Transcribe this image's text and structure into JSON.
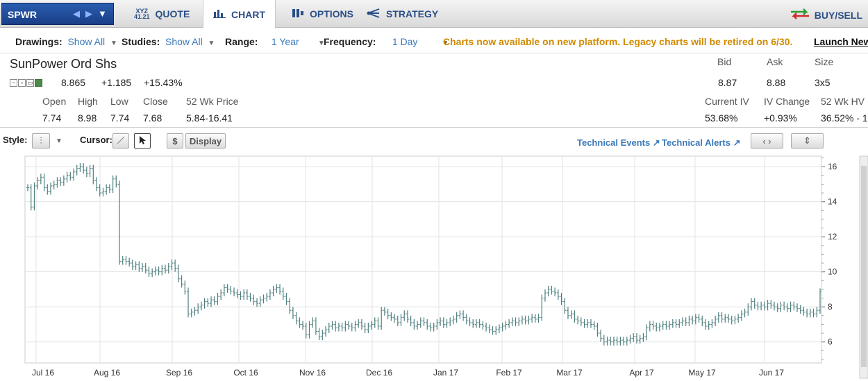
{
  "header": {
    "symbol": "SPWR",
    "tabs": [
      {
        "label": "QUOTE",
        "icon": "xyz-quote-icon",
        "icon_text_top": "XYZ",
        "icon_text_bottom": "41.21"
      },
      {
        "label": "CHART",
        "icon": "bar-chart-icon"
      },
      {
        "label": "OPTIONS",
        "icon": "options-icon"
      },
      {
        "label": "STRATEGY",
        "icon": "strategy-icon"
      }
    ],
    "active_tab": "CHART",
    "buysell_label": "BUY/SELL"
  },
  "controls": {
    "drawings_label": "Drawings:",
    "drawings_value": "Show All",
    "studies_label": "Studies:",
    "studies_value": "Show All",
    "range_label": "Range:",
    "range_value": "1 Year",
    "frequency_label": "Frequency:",
    "frequency_value": "1 Day",
    "notice": "Charts now available on new platform. Legacy charts will be retired on 6/30.",
    "launch_label": "Launch New"
  },
  "quote": {
    "name": "SunPower Ord Shs",
    "last": "8.865",
    "change": "+1.185",
    "change_pct": "+15.43%",
    "open_label": "Open",
    "open": "7.74",
    "high_label": "High",
    "high": "8.98",
    "low_label": "Low",
    "low": "7.74",
    "close_label": "Close",
    "close": "7.68",
    "wk52_label": "52 Wk Price",
    "wk52": "5.84-16.41",
    "bid_label": "Bid",
    "bid": "8.87",
    "ask_label": "Ask",
    "ask": "8.88",
    "size_label": "Size",
    "size": "3x5",
    "iv_label": "Current IV",
    "iv": "53.68%",
    "ivchg_label": "IV Change",
    "ivchg": "+0.93%",
    "hv_label": "52 Wk HV",
    "hv": "36.52% - 1"
  },
  "toolbar": {
    "style_label": "Style:",
    "cursor_label": "Cursor:",
    "dollar_label": "$",
    "display_label": "Display",
    "tech_events": "Technical Events",
    "tech_alerts": "Technical Alerts"
  },
  "colors": {
    "bars": "#4f7f7f",
    "accent": "#3a79b8",
    "notice": "#d08a00"
  },
  "chart_data": {
    "type": "ohlc",
    "title": "",
    "xlabel": "",
    "ylabel": "",
    "ylim": [
      4.8,
      16.6
    ],
    "yticks": [
      6,
      8,
      10,
      12,
      14,
      16
    ],
    "x_labels": [
      "Jul 16",
      "Aug 16",
      "Sep 16",
      "Oct 16",
      "Nov 16",
      "Dec 16",
      "Jan 17",
      "Feb 17",
      "Mar 17",
      "Apr 17",
      "May 17",
      "Jun 17"
    ],
    "grid": true,
    "series": [
      {
        "period": "Jul 16",
        "closes": [
          14.8,
          13.7,
          14.9,
          15.2,
          15.4,
          14.8,
          14.6,
          14.9,
          15.0,
          15.2,
          15.1,
          15.3,
          15.5,
          15.4,
          15.7,
          15.9,
          16.0,
          15.8,
          15.6,
          15.9
        ]
      },
      {
        "period": "Aug 16",
        "closes": [
          15.2,
          14.8,
          14.5,
          14.6,
          14.8,
          14.7,
          15.3,
          15.0,
          10.6,
          10.7,
          10.6,
          10.5,
          10.3,
          10.4,
          10.2,
          10.3,
          10.1,
          9.9,
          10.0,
          10.1,
          10.0
        ]
      },
      {
        "period": "Sep 16",
        "closes": [
          10.2,
          10.1,
          10.3,
          10.5,
          10.2,
          9.6,
          9.3,
          8.9,
          7.6,
          7.7,
          7.8,
          8.0,
          8.1,
          8.3,
          8.2,
          8.4,
          8.3,
          8.6,
          8.8,
          9.1,
          9.0
        ]
      },
      {
        "period": "Oct 16",
        "closes": [
          8.9,
          8.8,
          8.7,
          8.6,
          8.8,
          8.6,
          8.5,
          8.3,
          8.2,
          8.4,
          8.5,
          8.6,
          8.8,
          9.0,
          9.1,
          8.9,
          8.6,
          8.3,
          7.8,
          7.5,
          7.2
        ]
      },
      {
        "period": "Nov 16",
        "closes": [
          7.0,
          6.9,
          6.4,
          7.0,
          7.2,
          6.6,
          6.3,
          6.5,
          6.7,
          6.9,
          7.0,
          6.8,
          6.9,
          6.8,
          7.0,
          6.9,
          6.8,
          7.0,
          7.1,
          6.9,
          6.7
        ]
      },
      {
        "period": "Dec 16",
        "closes": [
          6.9,
          7.0,
          7.2,
          6.9,
          7.8,
          7.7,
          7.5,
          7.4,
          7.3,
          7.1,
          7.4,
          7.6,
          7.3,
          7.1,
          6.9,
          7.0,
          7.2,
          7.1,
          6.9,
          6.8,
          6.9
        ]
      },
      {
        "period": "Jan 17",
        "closes": [
          7.1,
          7.2,
          7.0,
          7.1,
          7.2,
          7.3,
          7.5,
          7.6,
          7.4,
          7.2,
          7.1,
          7.0,
          7.1,
          7.0,
          6.9,
          6.8,
          6.7,
          6.6,
          6.7,
          6.8,
          6.9
        ]
      },
      {
        "period": "Feb 17",
        "closes": [
          7.0,
          7.1,
          7.2,
          7.1,
          7.2,
          7.3,
          7.2,
          7.3,
          7.4,
          7.3,
          7.4,
          8.5,
          8.8,
          9.0,
          8.9,
          8.8,
          8.6,
          8.3,
          7.8,
          7.5,
          7.6
        ]
      },
      {
        "period": "Mar 17",
        "closes": [
          7.3,
          7.2,
          7.1,
          7.0,
          7.1,
          7.0,
          6.9,
          6.5,
          6.2,
          6.0,
          6.1,
          6.0,
          6.1,
          6.0,
          6.1,
          6.0,
          6.1,
          6.2,
          6.3,
          6.1,
          6.2
        ]
      },
      {
        "period": "Apr 17",
        "closes": [
          6.3,
          6.8,
          7.0,
          6.9,
          6.8,
          6.9,
          7.0,
          6.9,
          7.0,
          7.1,
          7.0,
          7.1,
          7.2,
          7.1,
          7.3,
          7.2,
          7.4,
          7.3,
          7.1,
          6.9,
          7.0
        ]
      },
      {
        "period": "May 17",
        "closes": [
          7.1,
          7.3,
          7.5,
          7.3,
          7.4,
          7.3,
          7.2,
          7.3,
          7.4,
          7.6,
          7.7,
          8.0,
          8.3,
          8.1,
          8.0,
          8.1,
          8.0,
          8.2,
          8.1,
          8.0,
          7.9
        ]
      },
      {
        "period": "Jun 17",
        "closes": [
          8.1,
          8.0,
          7.9,
          8.1,
          8.0,
          7.9,
          7.8,
          7.7,
          7.6,
          7.7,
          7.6,
          7.8,
          8.86
        ]
      }
    ]
  }
}
